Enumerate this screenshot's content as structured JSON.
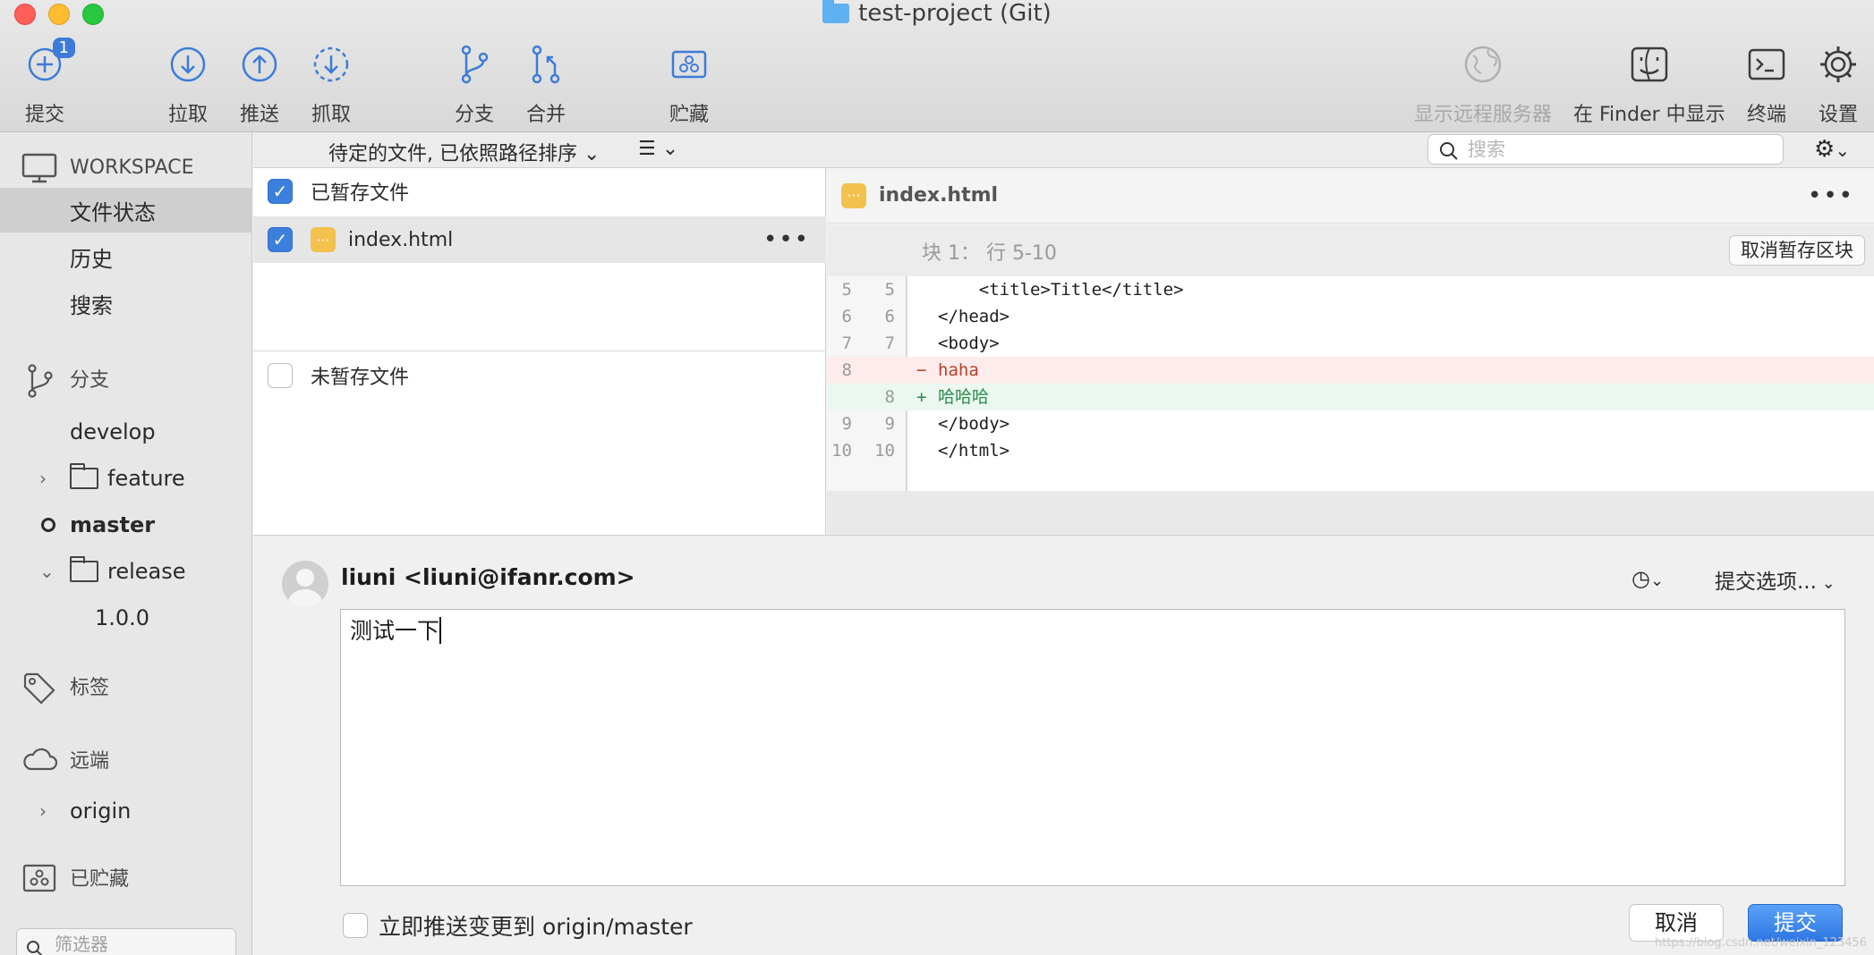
{
  "window": {
    "title": "test-project (Git)"
  },
  "toolbar": {
    "commit": {
      "label": "提交",
      "badge": "1"
    },
    "pull": {
      "label": "拉取"
    },
    "push": {
      "label": "推送"
    },
    "fetch": {
      "label": "抓取"
    },
    "branch": {
      "label": "分支"
    },
    "merge": {
      "label": "合并"
    },
    "stash": {
      "label": "贮藏"
    },
    "show_remote": {
      "label": "显示远程服务器"
    },
    "show_finder": {
      "label": "在 Finder 中显示"
    },
    "terminal": {
      "label": "终端"
    },
    "settings": {
      "label": "设置"
    }
  },
  "sidebar": {
    "workspace": "WORKSPACE",
    "file_status": "文件状态",
    "history": "历史",
    "search": "搜索",
    "branches": "分支",
    "branch_develop": "develop",
    "branch_feature": "feature",
    "branch_master": "master",
    "branch_release": "release",
    "branch_release_100": "1.0.0",
    "tags": "标签",
    "remotes": "远端",
    "remote_origin": "origin",
    "stashes": "已贮藏",
    "filter_placeholder": "筛选器"
  },
  "subbar": {
    "sort_label": "待定的文件, 已依照路径排序",
    "search_placeholder": "搜索"
  },
  "files": {
    "staged_header": "已暂存文件",
    "staged_items": [
      {
        "name": "index.html"
      }
    ],
    "unstaged_header": "未暂存文件"
  },
  "diff": {
    "file": "index.html",
    "hunk_label": "块 1： 行 5-10",
    "unstage_hunk": "取消暂存区块",
    "lines": [
      {
        "old": "5",
        "new": "5",
        "sign": "",
        "text": "    <title>Title</title>",
        "type": "ctx"
      },
      {
        "old": "6",
        "new": "6",
        "sign": "",
        "text": "</head>",
        "type": "ctx"
      },
      {
        "old": "7",
        "new": "7",
        "sign": "",
        "text": "<body>",
        "type": "ctx"
      },
      {
        "old": "8",
        "new": "",
        "sign": "−",
        "text": "haha",
        "type": "del"
      },
      {
        "old": "",
        "new": "8",
        "sign": "+",
        "text": "哈哈哈",
        "type": "add"
      },
      {
        "old": "9",
        "new": "9",
        "sign": "",
        "text": "</body>",
        "type": "ctx"
      },
      {
        "old": "10",
        "new": "10",
        "sign": "",
        "text": "</html>",
        "type": "ctx"
      }
    ]
  },
  "commit": {
    "author": "liuni <liuni@ifanr.com>",
    "options": "提交选项...",
    "message": "测试一下",
    "push_option": "立即推送变更到 origin/master",
    "cancel": "取消",
    "submit": "提交"
  },
  "watermark": "https://blog.csdn.net/weixin_123456",
  "colors": {
    "accent": "#3d7fdc",
    "file_badge": "#f2c14e",
    "del_bg": "#fdeceb",
    "add_bg": "#eaf8ef"
  }
}
